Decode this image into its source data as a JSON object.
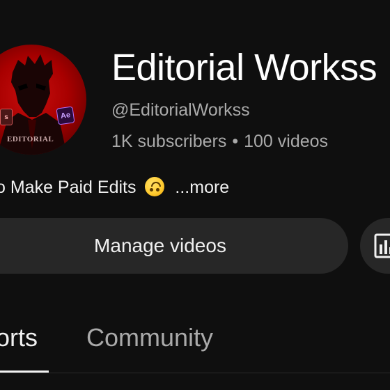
{
  "channel": {
    "name": "Editorial Workss",
    "handle": "@EditorialWorkss",
    "subscribers": "1K subscribers",
    "separator": "•",
    "videos": "100 videos",
    "avatar_text": "EDITORIAL",
    "avatar_badge_ae": "Ae",
    "avatar_badge_ps": "s"
  },
  "description": {
    "text": "o Make Paid Edits",
    "emoji": "upside-down-face",
    "more_label": "...more"
  },
  "actions": {
    "manage_label": "Manage videos",
    "analytics_icon": "analytics-icon"
  },
  "tabs": [
    {
      "label": "orts",
      "active": true
    },
    {
      "label": "Community",
      "active": false
    }
  ],
  "colors": {
    "background": "#0f0f0f",
    "button_bg": "#272727",
    "primary_text": "#f1f1f1",
    "secondary_text": "#aaaaaa",
    "avatar_red": "#c80f0f"
  }
}
